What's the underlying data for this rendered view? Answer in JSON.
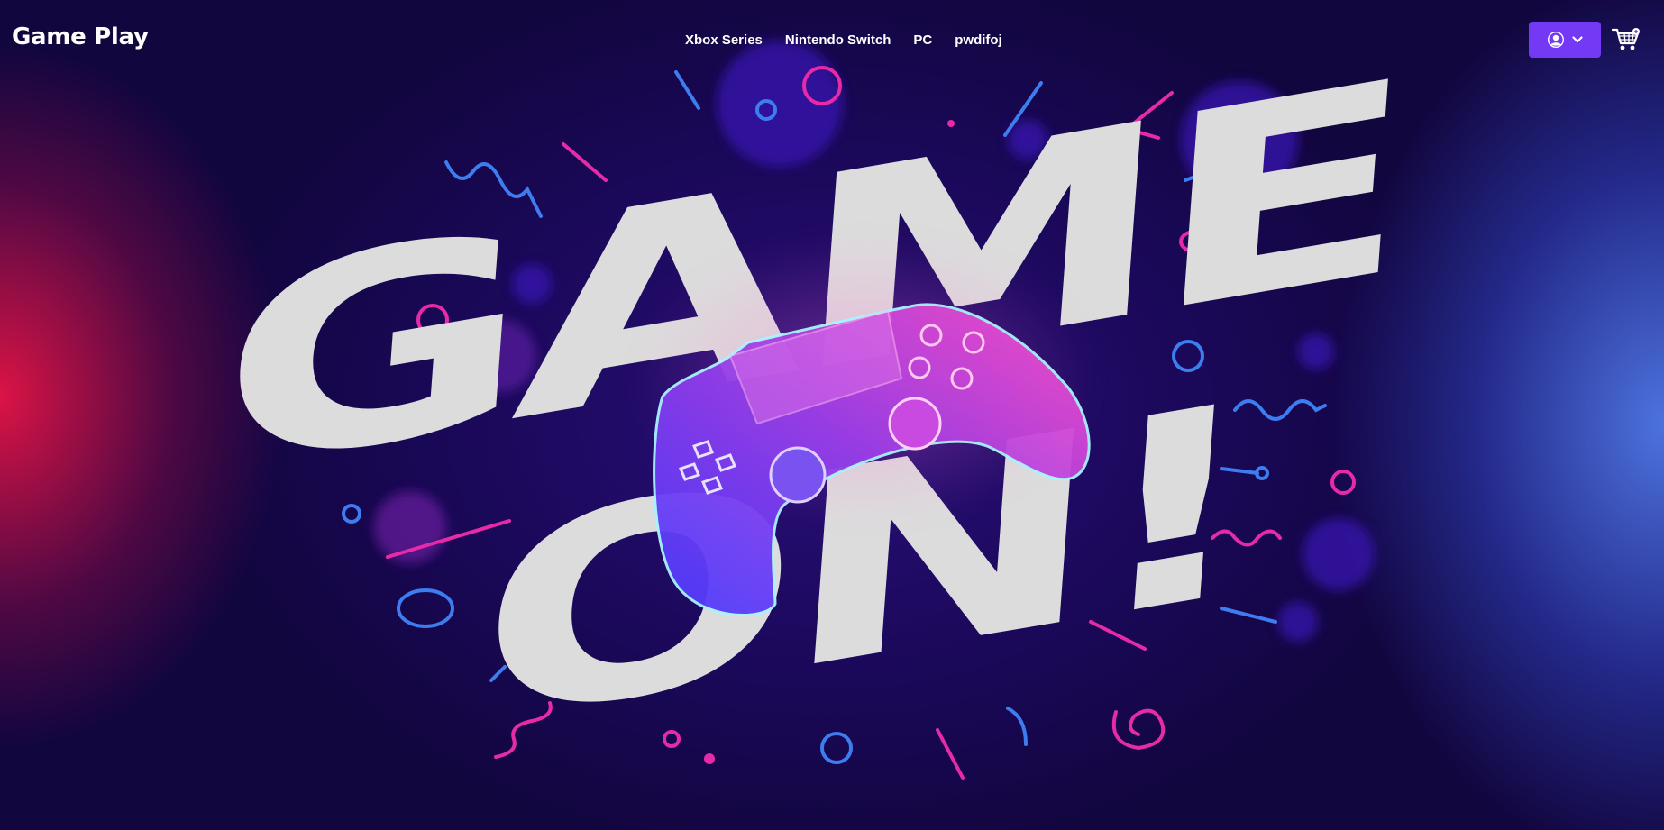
{
  "header": {
    "brand": "Game Play",
    "nav": [
      {
        "label": "Xbox Series"
      },
      {
        "label": "Nintendo Switch"
      },
      {
        "label": "PC"
      },
      {
        "label": "pwdifoj"
      }
    ],
    "user_menu_icon": "user-circle-icon",
    "user_menu_caret": "chevron-down-icon",
    "cart_icon": "cart-icon"
  },
  "hero": {
    "line1": "GAME",
    "line2": "ON!"
  },
  "colors": {
    "accent": "#7339f5",
    "pink": "#e62aa8",
    "blue": "#3d7df0",
    "background": "#1a0858",
    "text": "#ffffff",
    "hero_text": "#dddddd"
  }
}
